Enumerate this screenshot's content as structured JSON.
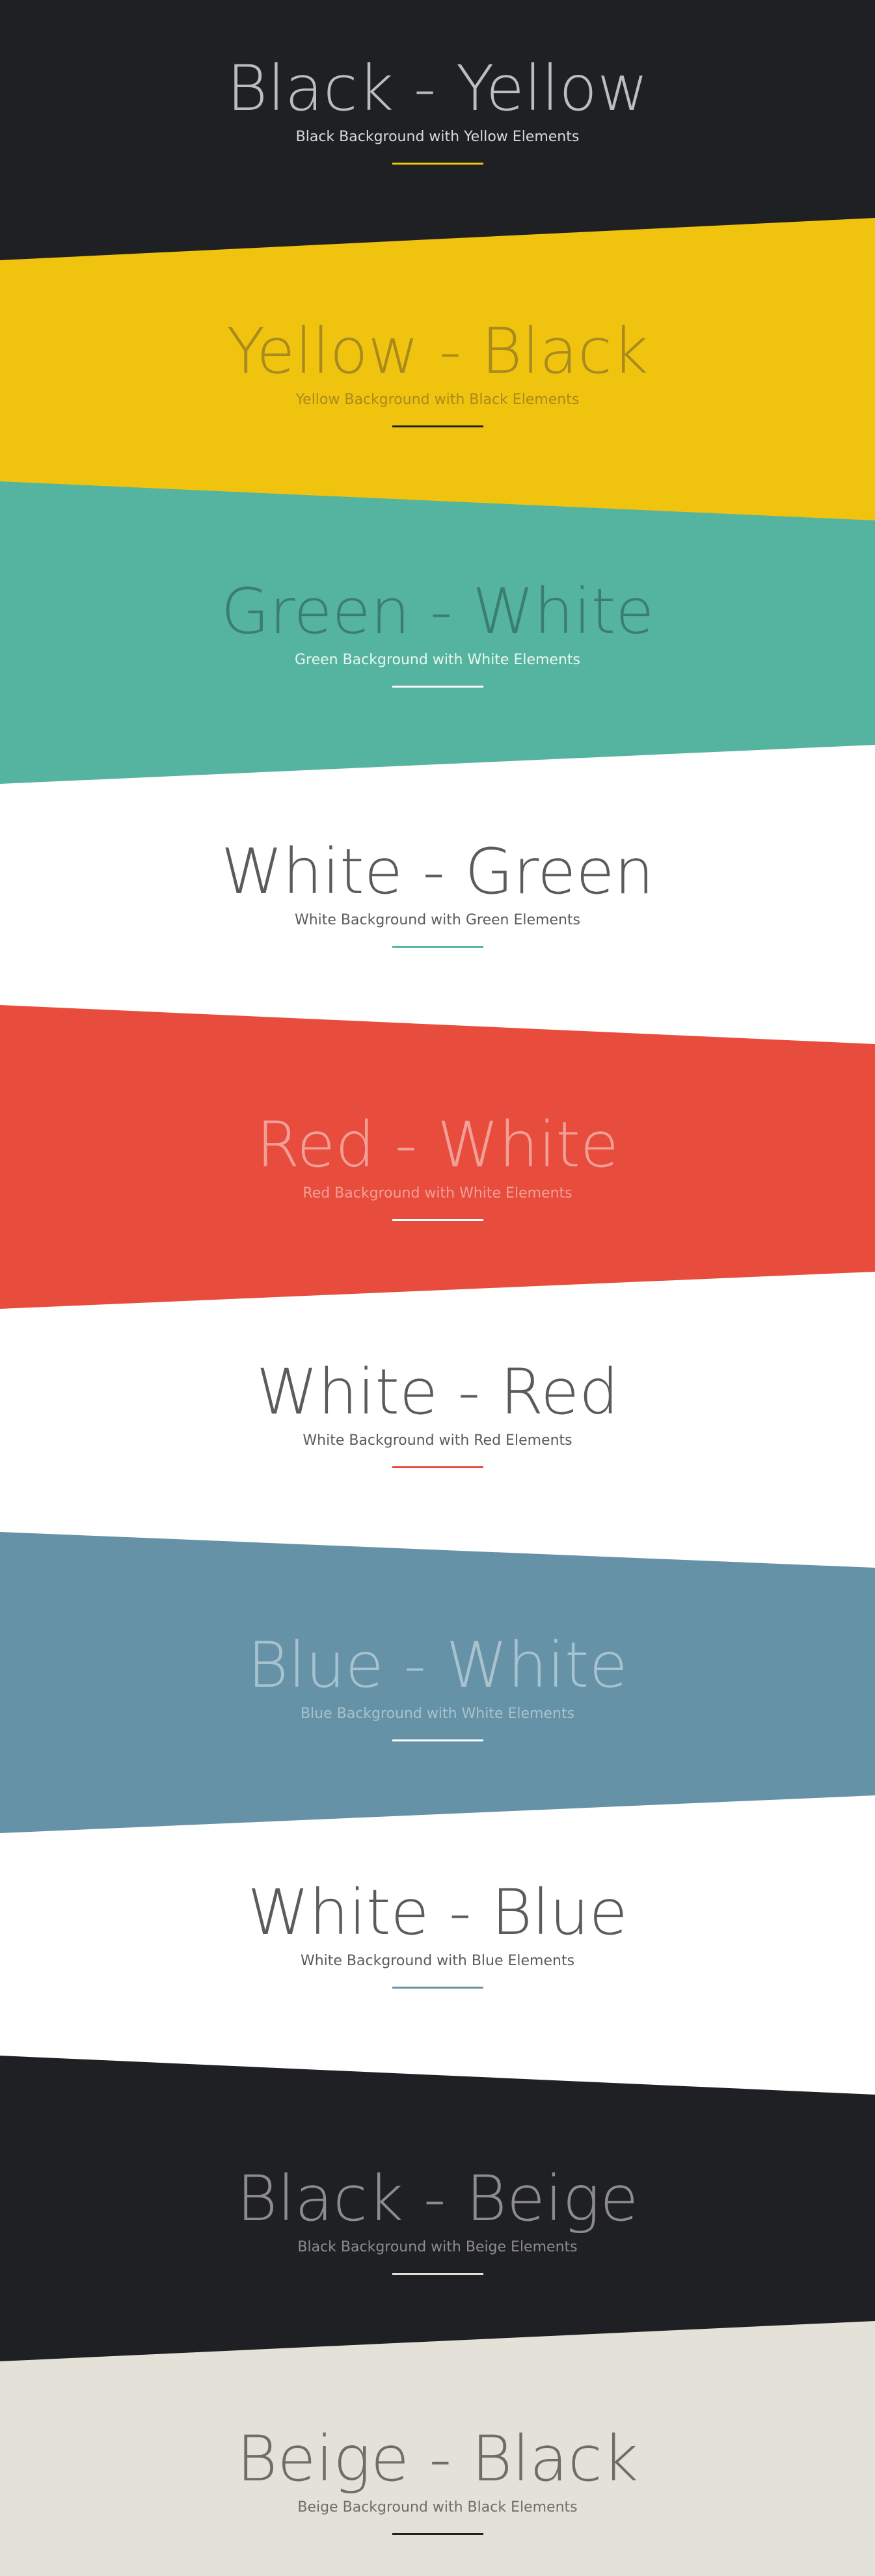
{
  "sections": [
    {
      "title": "Black - Yellow",
      "subtitle": "Black Background with Yellow Elements",
      "bg": "#1f2023",
      "title_color": "#bcbdbf",
      "subtitle_color": "#d8d9da",
      "accent": "#f0c30f"
    },
    {
      "title": "Yellow - Black",
      "subtitle": "Yellow Background with Black Elements",
      "bg": "#f0c30f",
      "title_color": "#a88a1e",
      "subtitle_color": "#a88a1e",
      "accent": "#1f2023"
    },
    {
      "title": "Green - White",
      "subtitle": "Green Background with White Elements",
      "bg": "#55b49f",
      "title_color": "#3b7e70",
      "subtitle_color": "#e9f6f2",
      "accent": "#ffffff"
    },
    {
      "title": "White - Green",
      "subtitle": "White Background with Green Elements",
      "bg": "#ffffff",
      "title_color": "#5b5b5b",
      "subtitle_color": "#5b5b5b",
      "accent": "#55b49f"
    },
    {
      "title": "Red - White",
      "subtitle": "Red Background with White Elements",
      "bg": "#e84c3d",
      "title_color": "#f1a098",
      "subtitle_color": "#f1a098",
      "accent": "#ffffff"
    },
    {
      "title": "White - Red",
      "subtitle": "White Background with Red Elements",
      "bg": "#ffffff",
      "title_color": "#5b5b5b",
      "subtitle_color": "#5b5b5b",
      "accent": "#e84c3d"
    },
    {
      "title": "Blue - White",
      "subtitle": "Blue Background with White Elements",
      "bg": "#6592a6",
      "title_color": "#a7c2ce",
      "subtitle_color": "#a7c2ce",
      "accent": "#ffffff"
    },
    {
      "title": "White - Blue",
      "subtitle": "White Background with Blue Elements",
      "bg": "#ffffff",
      "title_color": "#5b5b5b",
      "subtitle_color": "#5b5b5b",
      "accent": "#6592a6"
    },
    {
      "title": "Black - Beige",
      "subtitle": "Black Background with Beige Elements",
      "bg": "#1f2023",
      "title_color": "#8c8c8c",
      "subtitle_color": "#8c8c8c",
      "accent": "#e4e1d8"
    },
    {
      "title": "Beige - Black",
      "subtitle": "Beige Background with Black Elements",
      "bg": "#e4e1d8",
      "title_color": "#6e6d6a",
      "subtitle_color": "#6e6d6a",
      "accent": "#1f2023"
    }
  ]
}
